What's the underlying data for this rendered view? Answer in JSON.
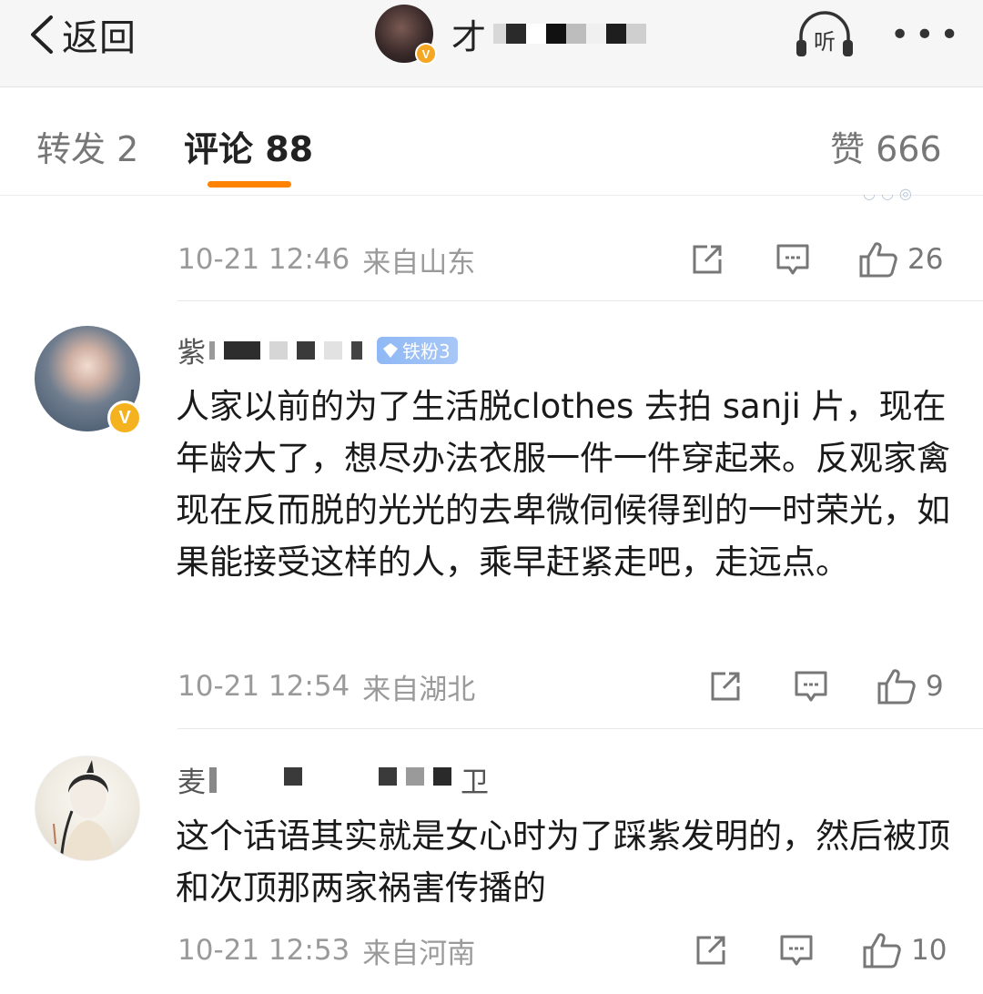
{
  "topbar": {
    "back_label": "返回",
    "title_prefix": "才",
    "verified_badge": "V",
    "listen_label": "听",
    "more_label": "•••"
  },
  "tabs": [
    {
      "label": "转发 2",
      "active": false
    },
    {
      "label": "评论 88",
      "active": true
    },
    {
      "label": "赞 666",
      "active": false
    }
  ],
  "accent_color": "#ff8200",
  "comments": [
    {
      "time": "10-21 12:46",
      "location": "来自山东",
      "likes": "26",
      "partial": true
    },
    {
      "user_prefix": "紫",
      "fan_badge": "铁粉3",
      "verified": "V",
      "text": "人家以前的为了生活脱clothes 去拍 sanji 片，现在年龄大了，想尽办法衣服一件一件穿起来。反观家禽现在反而脱的光光的去卑微伺候得到的一时荣光，如果能接受这样的人，乘早赶紧走吧，走远点。",
      "time": "10-21 12:54",
      "location": "来自湖北",
      "likes": "9"
    },
    {
      "user_prefix": "麦",
      "user_suffix": "卫",
      "text": "这个话语其实就是女心时为了踩紫发明的，然后被顶和次顶那两家祸害传播的",
      "time": "10-21 12:53",
      "location": "来自河南",
      "likes": "10"
    }
  ],
  "icons": {
    "back": "chevron-left-icon",
    "listen": "headphones-icon",
    "repost": "repost-icon",
    "comment": "comment-icon",
    "like": "thumbs-up-icon"
  }
}
